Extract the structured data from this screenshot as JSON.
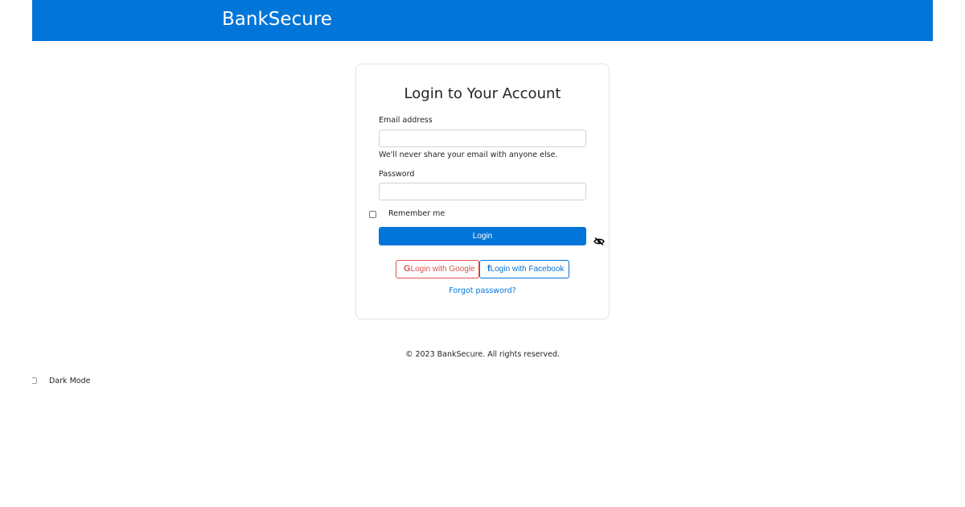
{
  "navbar": {
    "brand": "BankSecure"
  },
  "login": {
    "title": "Login to Your Account",
    "email_label": "Email address",
    "email_value": "",
    "email_help": "We'll never share your email with anyone else.",
    "password_label": "Password",
    "password_value": "",
    "remember_label": "Remember me",
    "remember_checked": false,
    "submit_label": "Login",
    "google_icon": "G",
    "google_label": "Login with Google",
    "facebook_icon": "f",
    "facebook_label": "Login with Facebook",
    "forgot_label": "Forgot password?"
  },
  "footer": {
    "copyright": "© 2023 BankSecure. All rights reserved."
  },
  "dark_mode": {
    "label": "Dark Mode",
    "enabled": false
  },
  "icons": {
    "password_visibility": "eye-slash-icon",
    "google": "google-icon",
    "facebook": "facebook-icon"
  },
  "colors": {
    "primary": "#0275d8",
    "google": "#d9534f",
    "text": "#212529",
    "border": "#ced4da"
  }
}
